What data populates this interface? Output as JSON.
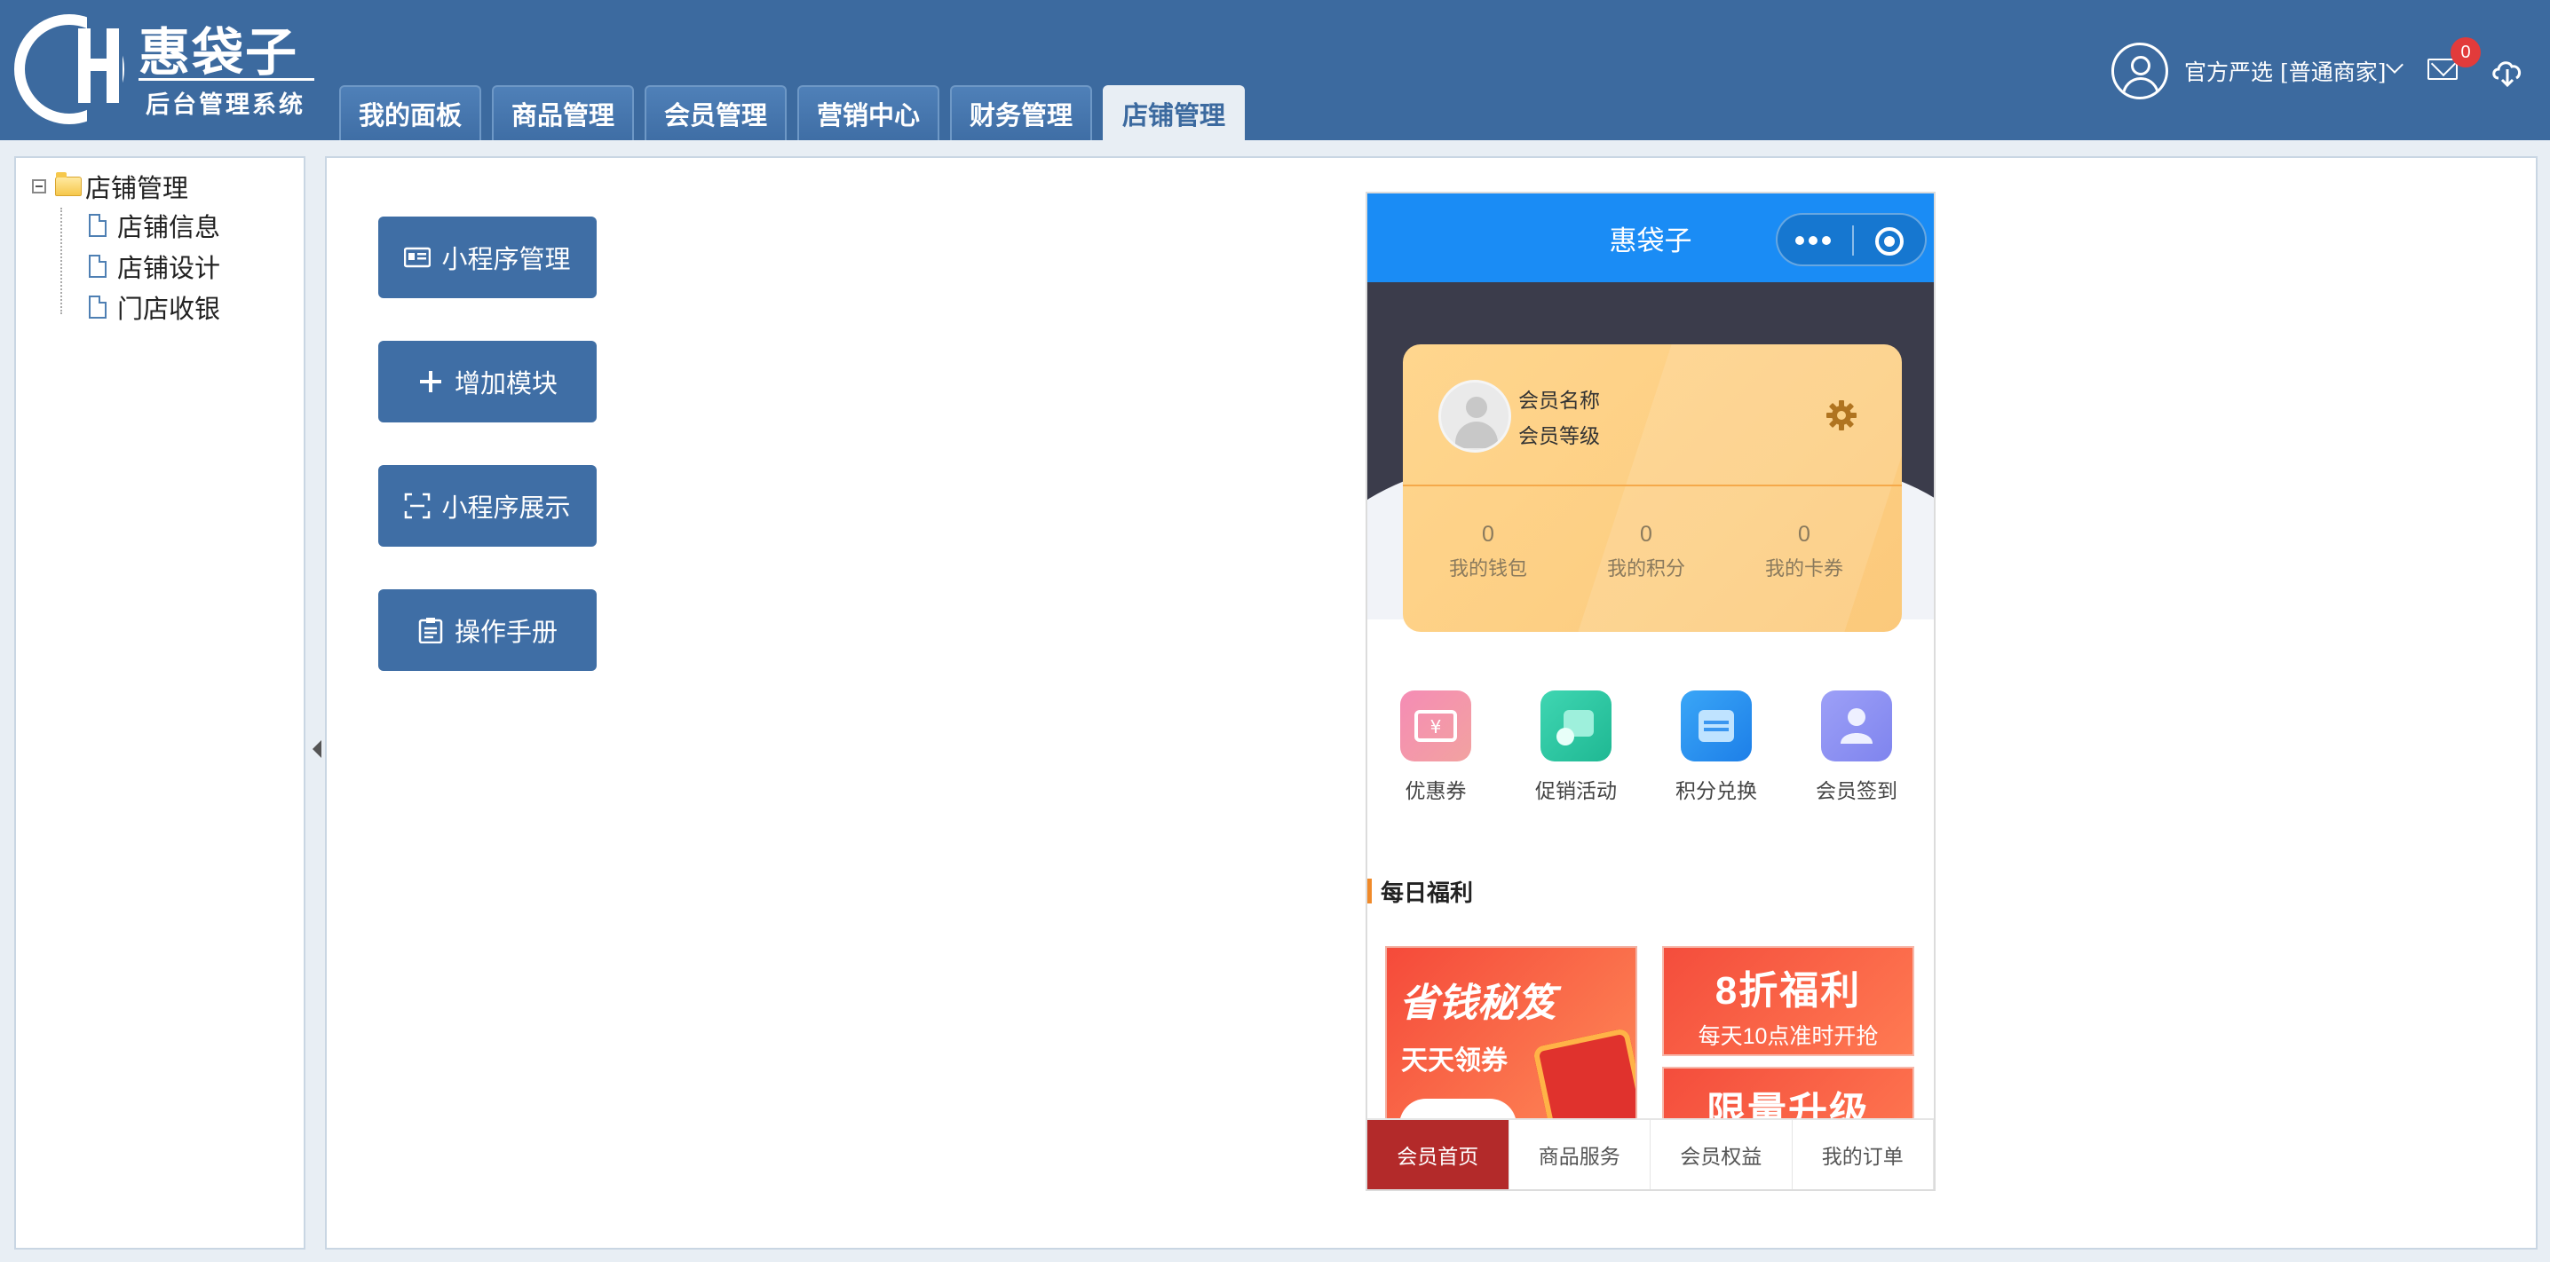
{
  "app": {
    "logo_title": "惠袋子",
    "logo_subtitle": "后台管理系统"
  },
  "header": {
    "tabs": [
      {
        "label": "我的面板"
      },
      {
        "label": "商品管理"
      },
      {
        "label": "会员管理"
      },
      {
        "label": "营销中心"
      },
      {
        "label": "财务管理"
      },
      {
        "label": "店铺管理",
        "active": true
      }
    ],
    "user_name": "官方严选 [普通商家]",
    "mail_count": "0",
    "accent_color": "#3c6a9f"
  },
  "sidebar": {
    "root_label": "店铺管理",
    "items": [
      {
        "label": "店铺信息"
      },
      {
        "label": "店铺设计"
      },
      {
        "label": "门店收银"
      }
    ]
  },
  "main": {
    "actions": [
      {
        "label": "小程序管理",
        "icon": "id-card-icon"
      },
      {
        "label": "增加模块",
        "icon": "plus-icon"
      },
      {
        "label": "小程序展示",
        "icon": "scan-icon"
      },
      {
        "label": "操作手册",
        "icon": "clipboard-icon"
      }
    ]
  },
  "phone": {
    "title": "惠袋子",
    "member": {
      "name": "会员名称",
      "level": "会员等级",
      "stats": [
        {
          "value": "0",
          "label": "我的钱包"
        },
        {
          "value": "0",
          "label": "我的积分"
        },
        {
          "value": "0",
          "label": "我的卡券"
        }
      ]
    },
    "quick": [
      {
        "label": "优惠券",
        "icon": "coupon-icon",
        "color": "#f27aa8"
      },
      {
        "label": "促销活动",
        "icon": "promotion-icon",
        "color": "#2ec9a8"
      },
      {
        "label": "积分兑换",
        "icon": "points-exchange-icon",
        "color": "#2e8ef0"
      },
      {
        "label": "会员签到",
        "icon": "member-checkin-icon",
        "color": "#8b8ff2"
      }
    ],
    "welfare_title": "每日福利",
    "promo_big": {
      "line1": "省钱秘笈",
      "line2": "天天领券"
    },
    "promo_8": {
      "title": "8折福利",
      "subtitle": "每天10点准时开抢"
    },
    "promo_upgrade": {
      "title": "限量升级"
    },
    "nav": [
      {
        "label": "会员首页",
        "active": true
      },
      {
        "label": "商品服务"
      },
      {
        "label": "会员权益"
      },
      {
        "label": "我的订单"
      }
    ]
  }
}
